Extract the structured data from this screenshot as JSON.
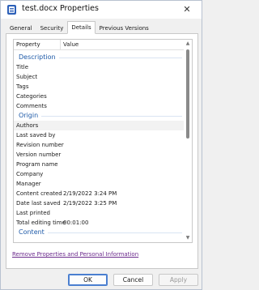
{
  "window": {
    "title": "test.docx Properties",
    "close_glyph": "✕",
    "app_icon": "word-document-icon"
  },
  "tabs": [
    {
      "label": "General",
      "active": false
    },
    {
      "label": "Security",
      "active": false
    },
    {
      "label": "Details",
      "active": true
    },
    {
      "label": "Previous Versions",
      "active": false
    }
  ],
  "list": {
    "headers": {
      "property": "Property",
      "value": "Value"
    },
    "groups": [
      {
        "name": "Description",
        "rows": [
          {
            "property": "Title",
            "value": ""
          },
          {
            "property": "Subject",
            "value": ""
          },
          {
            "property": "Tags",
            "value": ""
          },
          {
            "property": "Categories",
            "value": ""
          },
          {
            "property": "Comments",
            "value": ""
          }
        ]
      },
      {
        "name": "Origin",
        "rows": [
          {
            "property": "Authors",
            "value": ""
          },
          {
            "property": "Last saved by",
            "value": ""
          },
          {
            "property": "Revision number",
            "value": ""
          },
          {
            "property": "Version number",
            "value": ""
          },
          {
            "property": "Program name",
            "value": ""
          },
          {
            "property": "Company",
            "value": ""
          },
          {
            "property": "Manager",
            "value": ""
          },
          {
            "property": "Content created",
            "value": "2/19/2022 3:24 PM"
          },
          {
            "property": "Date last saved",
            "value": "2/19/2022 3:25 PM"
          },
          {
            "property": "Last printed",
            "value": ""
          },
          {
            "property": "Total editing time",
            "value": "00:01:00"
          }
        ]
      },
      {
        "name": "Content",
        "rows": []
      }
    ]
  },
  "remove_link": "Remove Properties and Personal Information",
  "buttons": {
    "ok": "OK",
    "cancel": "Cancel",
    "apply": "Apply"
  },
  "colors": {
    "group_header": "#1e5aa8",
    "link": "#6b2a8c",
    "accent": "#4a7fd0"
  }
}
